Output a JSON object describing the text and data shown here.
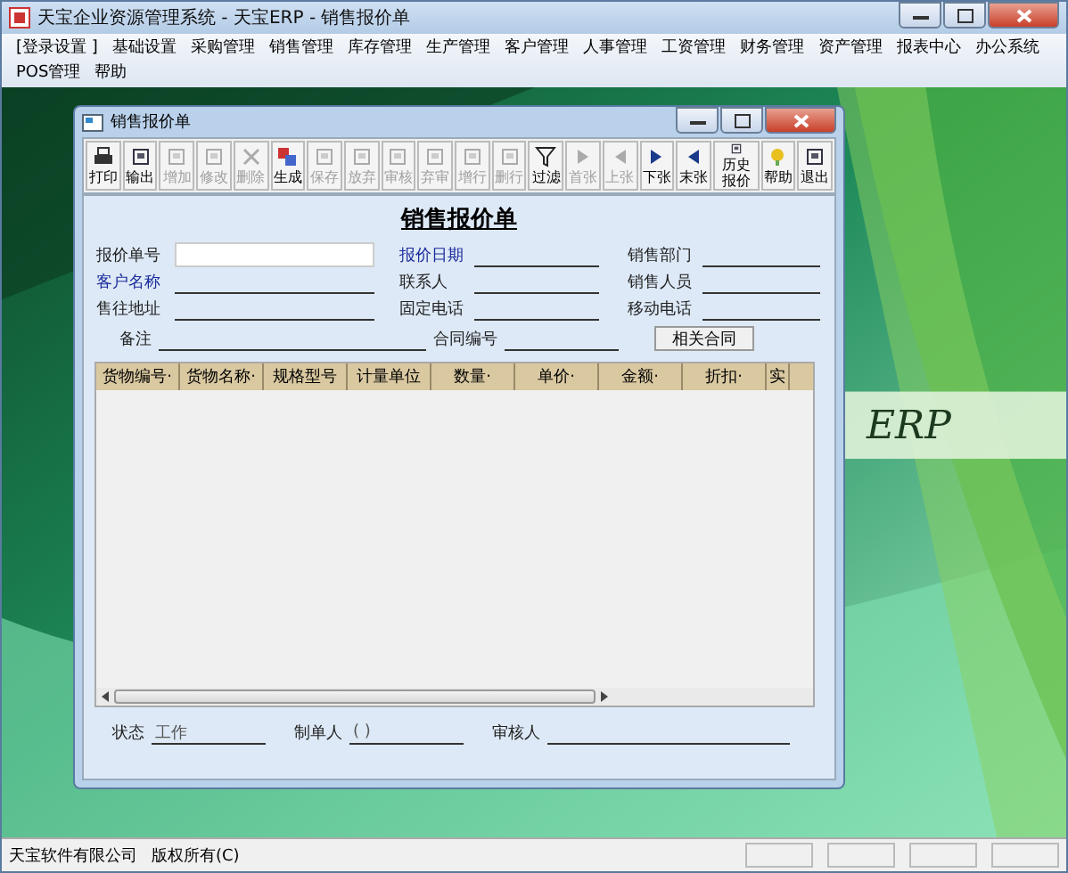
{
  "window": {
    "title": "天宝企业资源管理系统 - 天宝ERP - 销售报价单"
  },
  "menu": [
    "[登录设置 ]",
    "基础设置",
    "采购管理",
    "销售管理",
    "库存管理",
    "生产管理",
    "客户管理",
    "人事管理",
    "工资管理",
    "财务管理",
    "资产管理",
    "报表中心",
    "办公系统",
    "POS管理",
    "帮助"
  ],
  "brand": "ERP",
  "child_window": {
    "title": "销售报价单",
    "toolbar": [
      {
        "label": "打印",
        "disabled": false
      },
      {
        "label": "输出",
        "disabled": false
      },
      {
        "label": "增加",
        "disabled": true
      },
      {
        "label": "修改",
        "disabled": true
      },
      {
        "label": "删除",
        "disabled": true
      },
      {
        "label": "生成",
        "disabled": false
      },
      {
        "label": "保存",
        "disabled": true
      },
      {
        "label": "放弃",
        "disabled": true
      },
      {
        "label": "审核",
        "disabled": true
      },
      {
        "label": "弃审",
        "disabled": true
      },
      {
        "label": "增行",
        "disabled": true
      },
      {
        "label": "删行",
        "disabled": true
      },
      {
        "label": "过滤",
        "disabled": false
      },
      {
        "label": "首张",
        "disabled": true
      },
      {
        "label": "上张",
        "disabled": true
      },
      {
        "label": "下张",
        "disabled": false
      },
      {
        "label": "末张",
        "disabled": false
      },
      {
        "label": "历史报价",
        "disabled": false
      },
      {
        "label": "帮助",
        "disabled": false
      },
      {
        "label": "退出",
        "disabled": false
      }
    ],
    "form_title": "销售报价单",
    "fields": [
      {
        "label": "报价单号",
        "required": false,
        "kind": "input"
      },
      {
        "label": "报价日期",
        "required": true,
        "kind": "line"
      },
      {
        "label": "销售部门",
        "required": false,
        "kind": "line"
      },
      {
        "label": "客户名称",
        "required": true,
        "kind": "line"
      },
      {
        "label": "联系人",
        "required": false,
        "kind": "line"
      },
      {
        "label": "销售人员",
        "required": false,
        "kind": "line"
      },
      {
        "label": "售往地址",
        "required": false,
        "kind": "line"
      },
      {
        "label": "固定电话",
        "required": false,
        "kind": "line"
      },
      {
        "label": "移动电话",
        "required": false,
        "kind": "line"
      }
    ],
    "remark": {
      "label": "备注"
    },
    "contract": {
      "label": "合同编号",
      "button": "相关合同"
    },
    "table": {
      "columns": [
        "货物编号·",
        "货物名称·",
        "规格型号",
        "计量单位",
        "数量·",
        "单价·",
        "金额·",
        "折扣·",
        "实"
      ]
    },
    "footer": [
      {
        "label": "状态",
        "value": "工作"
      },
      {
        "label": "制单人",
        "value": "( )"
      },
      {
        "label": "审核人"
      }
    ]
  },
  "status_bar": [
    "天宝软件有限公司",
    "版权所有(C)"
  ]
}
